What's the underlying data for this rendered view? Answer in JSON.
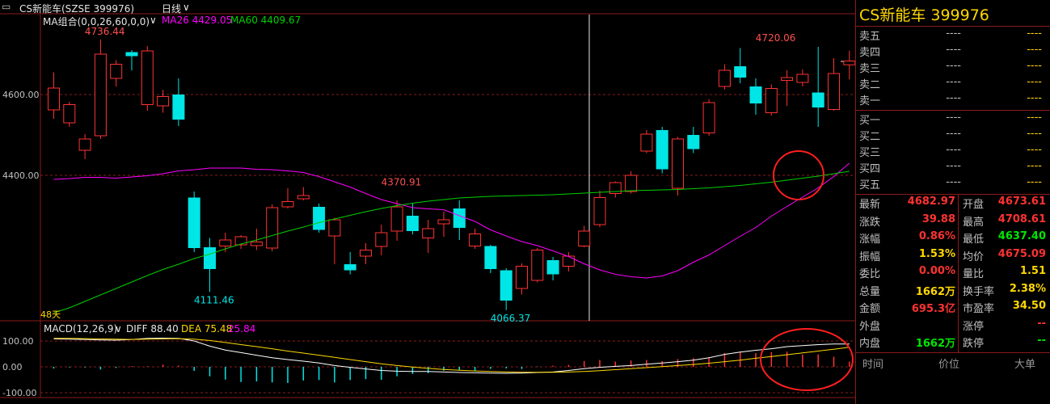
{
  "header": {
    "menu_icon": "collapse-icon",
    "security": "CS新能车(SZSE 399976)",
    "period": "日线",
    "chevron": "∨"
  },
  "ma_legend": {
    "name": "MA组合(0,0,26,60,0,0)",
    "ma26": "MA26 4429.05",
    "ma60": "MA60 4409.67",
    "chevron": "∨"
  },
  "macd_legend": {
    "name": "MACD(12,26,9)",
    "chevron": "∨",
    "diff": "DIFF 88.40",
    "dea": "DEA 75.48",
    "macd": "25.84"
  },
  "colors": {
    "up": "#ff3232",
    "down": "#00e5e5",
    "ma26": "#ff00ff",
    "ma60": "#00d000",
    "diff": "#ffffff",
    "dea": "#ffd800",
    "grid": "#8b1a1a",
    "annotation_circle": "#ff1f1f"
  },
  "chart_data": {
    "type": "candlestick",
    "price_axis_labels": [
      "4600.00",
      "4400.00"
    ],
    "macd_axis_labels": [
      "100.00",
      "0.00",
      "-100.00"
    ],
    "days_label": "48天",
    "annotations": {
      "high1": "4736.44",
      "high2": "4720.06",
      "mid": "4370.91",
      "low1": "4111.46",
      "low2": "4066.37"
    },
    "candles": [
      {
        "o": 4562,
        "c": 4616,
        "h": 4655,
        "l": 4540
      },
      {
        "o": 4530,
        "c": 4575,
        "h": 4582,
        "l": 4520
      },
      {
        "o": 4462,
        "c": 4490,
        "h": 4502,
        "l": 4440
      },
      {
        "o": 4498,
        "c": 4700,
        "h": 4736.44,
        "l": 4490
      },
      {
        "o": 4640,
        "c": 4675,
        "h": 4685,
        "l": 4620
      },
      {
        "o": 4705,
        "c": 4695,
        "h": 4710,
        "l": 4660
      },
      {
        "o": 4575,
        "c": 4708,
        "h": 4720,
        "l": 4560
      },
      {
        "o": 4572,
        "c": 4595,
        "h": 4612,
        "l": 4555
      },
      {
        "o": 4600,
        "c": 4538,
        "h": 4640,
        "l": 4522
      },
      {
        "o": 4345,
        "c": 4220,
        "h": 4360,
        "l": 4210
      },
      {
        "o": 4222,
        "c": 4168,
        "h": 4245,
        "l": 4111.46
      },
      {
        "o": 4225,
        "c": 4240,
        "h": 4258,
        "l": 4210
      },
      {
        "o": 4228,
        "c": 4248,
        "h": 4252,
        "l": 4218
      },
      {
        "o": 4226,
        "c": 4235,
        "h": 4268,
        "l": 4215
      },
      {
        "o": 4220,
        "c": 4320,
        "h": 4328,
        "l": 4212
      },
      {
        "o": 4322,
        "c": 4335,
        "h": 4368,
        "l": 4318
      },
      {
        "o": 4342,
        "c": 4350,
        "h": 4370.91,
        "l": 4338
      },
      {
        "o": 4322,
        "c": 4265,
        "h": 4330,
        "l": 4258
      },
      {
        "o": 4250,
        "c": 4290,
        "h": 4295,
        "l": 4180
      },
      {
        "o": 4180,
        "c": 4165,
        "h": 4210,
        "l": 4155
      },
      {
        "o": 4200,
        "c": 4215,
        "h": 4232,
        "l": 4180
      },
      {
        "o": 4224,
        "c": 4258,
        "h": 4278,
        "l": 4202
      },
      {
        "o": 4262,
        "c": 4322,
        "h": 4338,
        "l": 4238
      },
      {
        "o": 4300,
        "c": 4262,
        "h": 4330,
        "l": 4254
      },
      {
        "o": 4245,
        "c": 4268,
        "h": 4290,
        "l": 4208
      },
      {
        "o": 4280,
        "c": 4290,
        "h": 4310,
        "l": 4248
      },
      {
        "o": 4318,
        "c": 4270,
        "h": 4338,
        "l": 4240
      },
      {
        "o": 4225,
        "c": 4255,
        "h": 4268,
        "l": 4218
      },
      {
        "o": 4225,
        "c": 4168,
        "h": 4228,
        "l": 4158
      },
      {
        "o": 4165,
        "c": 4090,
        "h": 4170,
        "l": 4066.37
      },
      {
        "o": 4120,
        "c": 4175,
        "h": 4182,
        "l": 4105
      },
      {
        "o": 4140,
        "c": 4215,
        "h": 4220,
        "l": 4135
      },
      {
        "o": 4190,
        "c": 4155,
        "h": 4198,
        "l": 4140
      },
      {
        "o": 4175,
        "c": 4200,
        "h": 4210,
        "l": 4162
      },
      {
        "o": 4225,
        "c": 4262,
        "h": 4275,
        "l": 4222
      },
      {
        "o": 4278,
        "c": 4345,
        "h": 4362,
        "l": 4272
      },
      {
        "o": 4355,
        "c": 4382,
        "h": 4385,
        "l": 4345
      },
      {
        "o": 4360,
        "c": 4400,
        "h": 4410,
        "l": 4355
      },
      {
        "o": 4460,
        "c": 4502,
        "h": 4512,
        "l": 4455
      },
      {
        "o": 4512,
        "c": 4415,
        "h": 4520,
        "l": 4405
      },
      {
        "o": 4368,
        "c": 4490,
        "h": 4495,
        "l": 4350
      },
      {
        "o": 4500,
        "c": 4465,
        "h": 4520,
        "l": 4455
      },
      {
        "o": 4505,
        "c": 4580,
        "h": 4588,
        "l": 4498
      },
      {
        "o": 4620,
        "c": 4660,
        "h": 4675,
        "l": 4612
      },
      {
        "o": 4670,
        "c": 4642,
        "h": 4715,
        "l": 4628
      },
      {
        "o": 4620,
        "c": 4578,
        "h": 4640,
        "l": 4550
      },
      {
        "o": 4555,
        "c": 4615,
        "h": 4625,
        "l": 4548
      },
      {
        "o": 4635,
        "c": 4642,
        "h": 4660,
        "l": 4572
      },
      {
        "o": 4630,
        "c": 4650,
        "h": 4662,
        "l": 4620
      },
      {
        "o": 4605,
        "c": 4568,
        "h": 4718,
        "l": 4520
      },
      {
        "o": 4563,
        "c": 4652,
        "h": 4690,
        "l": 4560
      },
      {
        "o": 4673.61,
        "c": 4682.97,
        "h": 4708.61,
        "l": 4637.4
      }
    ],
    "ma26": [
      4390,
      4392,
      4395,
      4395,
      4393,
      4396,
      4399,
      4404,
      4411,
      4414,
      4418,
      4418,
      4418,
      4415,
      4414,
      4411,
      4407,
      4397,
      4384,
      4371,
      4355,
      4340,
      4330,
      4320,
      4317,
      4315,
      4300,
      4286,
      4265,
      4250,
      4236,
      4226,
      4213,
      4199,
      4181,
      4166,
      4155,
      4149,
      4146,
      4151,
      4164,
      4185,
      4203,
      4226,
      4249,
      4271,
      4299,
      4323,
      4346,
      4369,
      4397,
      4430
    ],
    "ma60": [
      4060,
      4072,
      4088,
      4104,
      4120,
      4136,
      4152,
      4167,
      4180,
      4194,
      4205,
      4218,
      4230,
      4240,
      4251,
      4262,
      4272,
      4283,
      4292,
      4301,
      4310,
      4318,
      4325,
      4331,
      4336,
      4340,
      4344,
      4346,
      4348,
      4349,
      4350,
      4351,
      4352,
      4354,
      4356,
      4358,
      4360,
      4362,
      4363,
      4364,
      4365,
      4367,
      4369,
      4372,
      4375,
      4379,
      4383,
      4388,
      4393,
      4398,
      4404,
      4410
    ],
    "macd_diff": [
      108,
      107,
      106,
      104,
      103,
      106,
      110,
      111,
      110,
      100,
      80,
      65,
      55,
      45,
      35,
      28,
      22,
      15,
      5,
      -2,
      -8,
      -14,
      -17,
      -18,
      -18,
      -20,
      -22,
      -23,
      -24,
      -25,
      -24,
      -22,
      -20,
      -14,
      -7,
      -2,
      2,
      5,
      10,
      15,
      20,
      26,
      35,
      48,
      57,
      64,
      70,
      78,
      82,
      86,
      88,
      88.4
    ],
    "macd_dea": [
      110,
      110,
      109,
      108,
      107,
      106,
      107,
      108,
      109,
      107,
      102,
      94,
      86,
      78,
      70,
      61,
      53,
      45,
      37,
      28,
      20,
      12,
      5,
      -1,
      -6,
      -10,
      -13,
      -16,
      -18,
      -20,
      -21,
      -21,
      -21,
      -20,
      -18,
      -15,
      -11,
      -7,
      -3,
      1,
      5,
      9,
      14,
      20,
      26,
      33,
      40,
      47,
      54,
      61,
      68,
      75.48
    ]
  },
  "panel": {
    "title": "CS新能车 399976",
    "asks": [
      {
        "label": "卖五",
        "price": "----",
        "vol": "----"
      },
      {
        "label": "卖四",
        "price": "----",
        "vol": "----"
      },
      {
        "label": "卖三",
        "price": "----",
        "vol": "----"
      },
      {
        "label": "卖二",
        "price": "----",
        "vol": "----"
      },
      {
        "label": "卖一",
        "price": "----",
        "vol": "----"
      }
    ],
    "bids": [
      {
        "label": "买一",
        "price": "----",
        "vol": "----"
      },
      {
        "label": "买二",
        "price": "----",
        "vol": "----"
      },
      {
        "label": "买三",
        "price": "----",
        "vol": "----"
      },
      {
        "label": "买四",
        "price": "----",
        "vol": "----"
      },
      {
        "label": "买五",
        "price": "----",
        "vol": "----"
      }
    ],
    "quotes": [
      {
        "l": "最新",
        "v": "4682.97",
        "vc": "red",
        "l2": "开盘",
        "v2": "4673.61",
        "vc2": "red"
      },
      {
        "l": "涨跌",
        "v": "39.88",
        "vc": "red",
        "l2": "最高",
        "v2": "4708.61",
        "vc2": "red"
      },
      {
        "l": "涨幅",
        "v": "0.86%",
        "vc": "red",
        "l2": "最低",
        "v2": "4637.40",
        "vc2": "green"
      },
      {
        "l": "振幅",
        "v": "1.53%",
        "vc": "yellow",
        "l2": "均价",
        "v2": "4675.09",
        "vc2": "red"
      },
      {
        "l": "委比",
        "v": "0.00%",
        "vc": "red",
        "l2": "量比",
        "v2": "1.51",
        "vc2": "yellow"
      },
      {
        "l": "总量",
        "v": "1662万",
        "vc": "yellow",
        "l2": "换手率",
        "v2": "2.38%",
        "vc2": "yellow"
      },
      {
        "l": "金额",
        "v": "695.3亿",
        "vc": "red",
        "l2": "市盈率",
        "v2": "34.50",
        "vc2": "yellow"
      },
      {
        "l": "外盘",
        "v": "",
        "vc": "red",
        "l2": "涨停",
        "v2": "--",
        "vc2": "red"
      },
      {
        "l": "内盘",
        "v": "1662万",
        "vc": "green",
        "l2": "跌停",
        "v2": "--",
        "vc2": "green"
      }
    ],
    "footer": [
      "时间",
      "价位",
      "大单"
    ]
  }
}
